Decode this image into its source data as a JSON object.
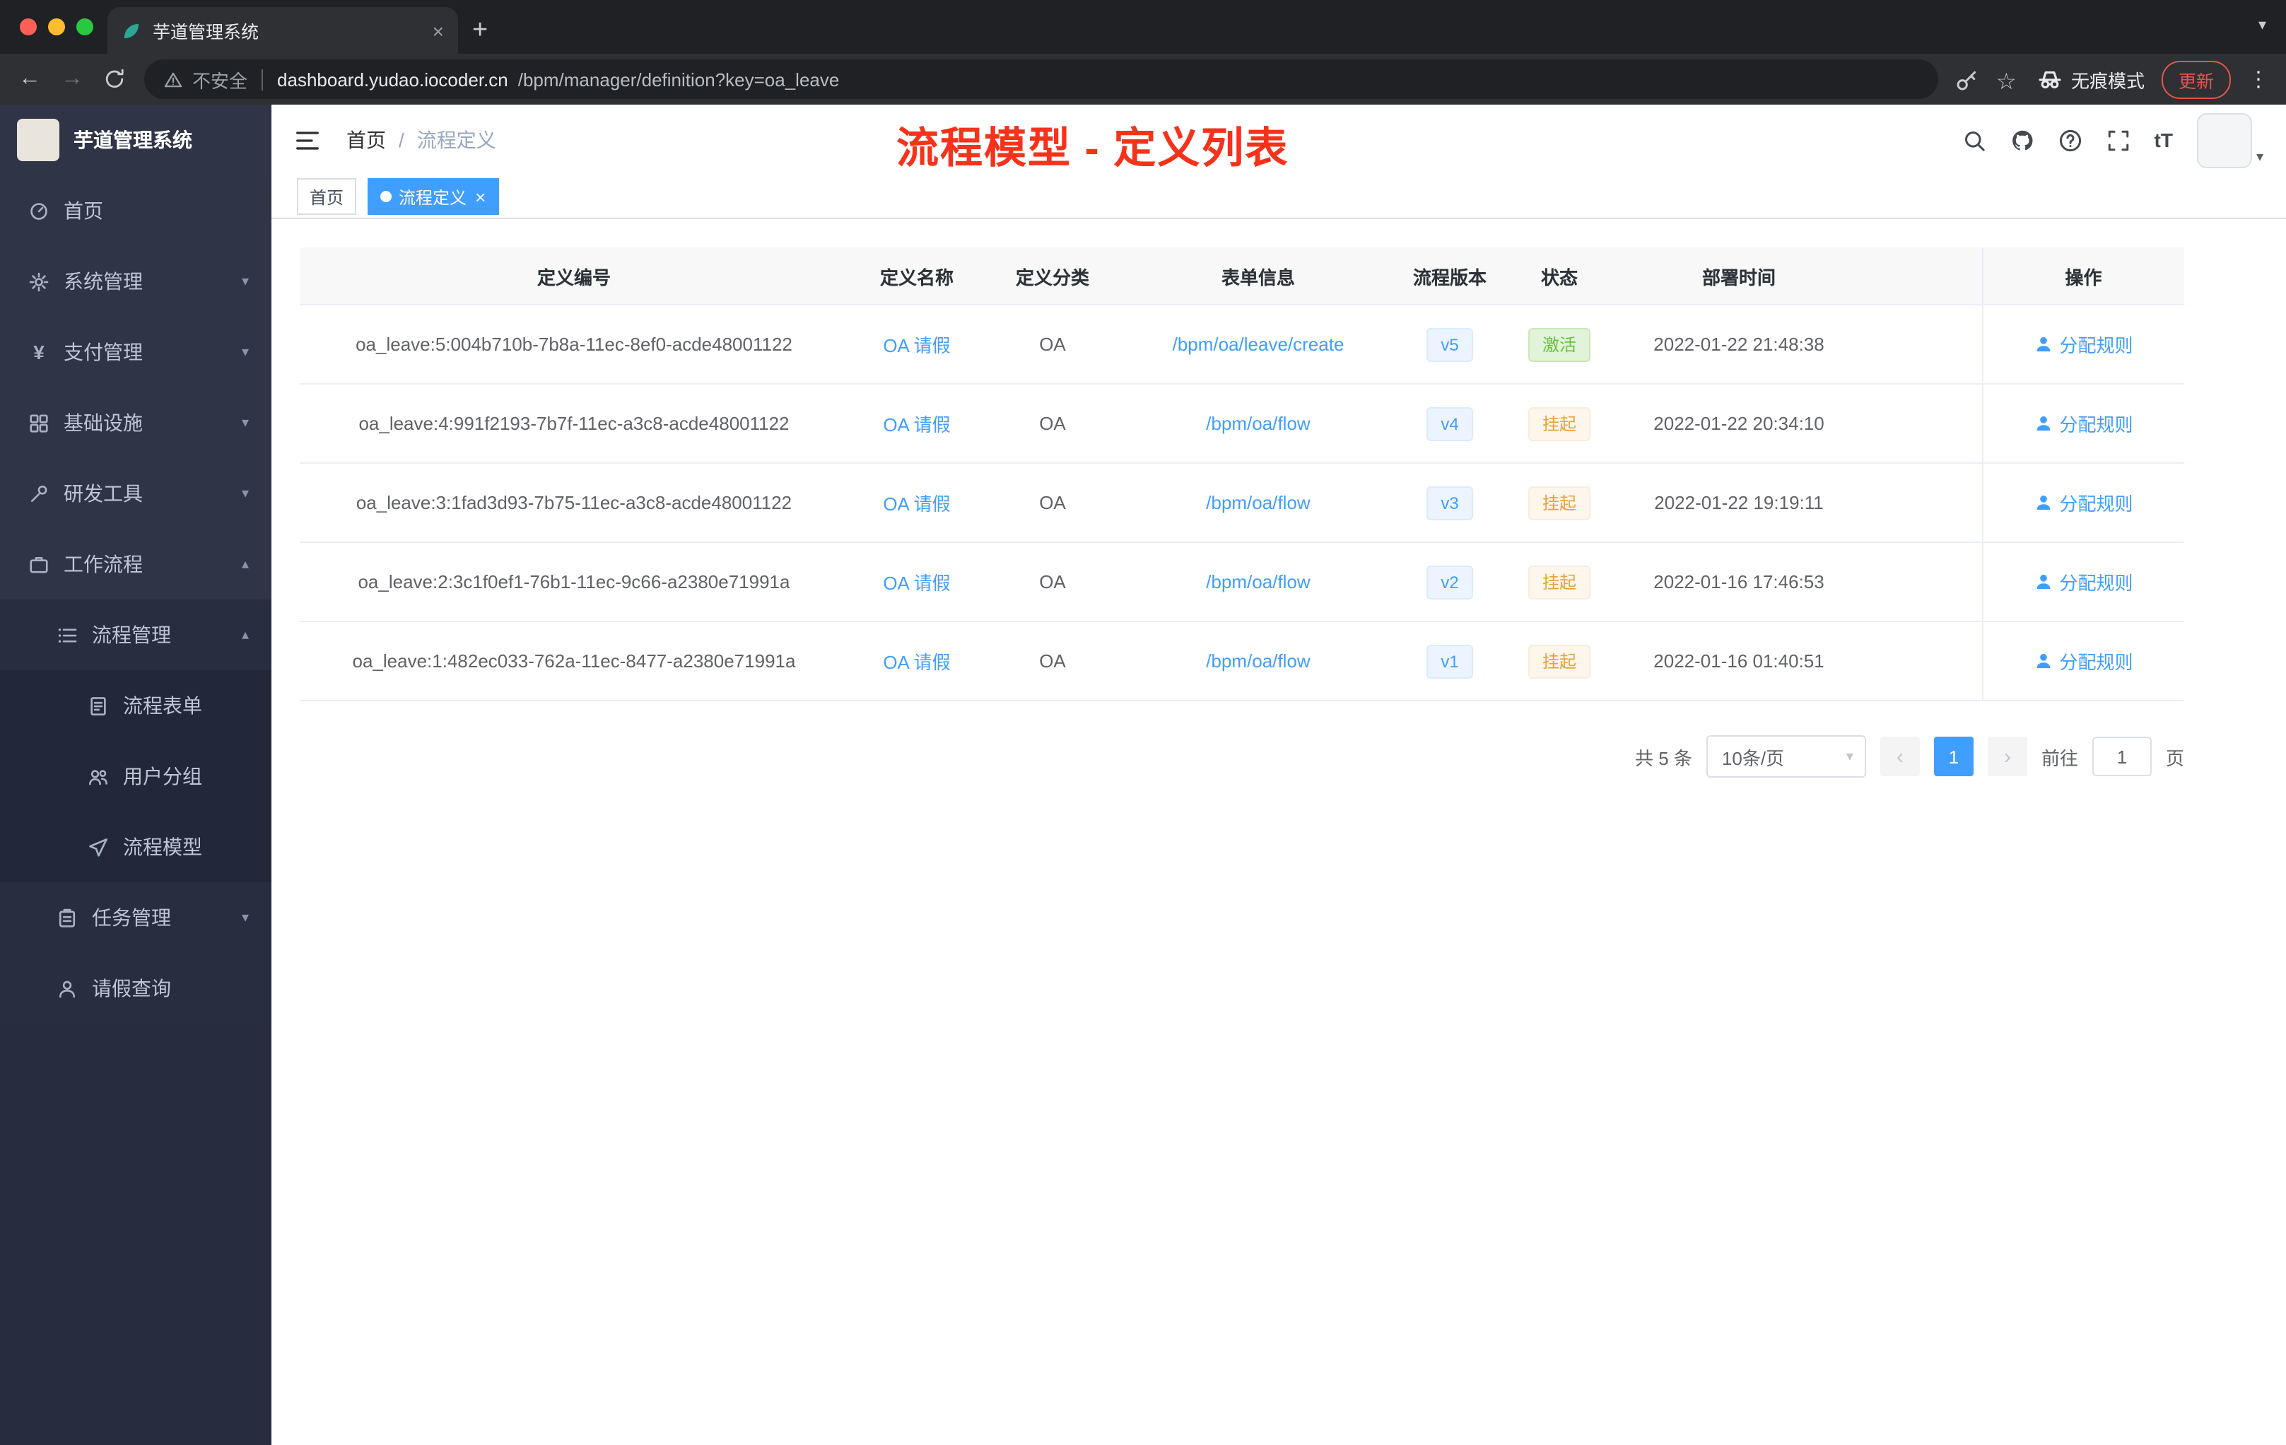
{
  "colors": {
    "primary": "#409eff",
    "success": "#67c23a",
    "warning": "#e6a23c",
    "annotation": "#f6321b"
  },
  "browser": {
    "tab_title": "芋道管理系统",
    "security_label": "不安全",
    "url_domain": "dashboard.yudao.iocoder.cn",
    "url_path": "/bpm/manager/definition?key=oa_leave",
    "incognito_label": "无痕模式",
    "update_label": "更新"
  },
  "sidebar": {
    "logo_title": "芋道管理系统",
    "items": [
      {
        "label": "首页",
        "icon": "dashboard-icon",
        "depth": 0,
        "chevron": null
      },
      {
        "label": "系统管理",
        "icon": "gear-icon",
        "depth": 0,
        "chevron": "down"
      },
      {
        "label": "支付管理",
        "icon": "yen-icon",
        "depth": 0,
        "chevron": "down"
      },
      {
        "label": "基础设施",
        "icon": "infra-icon",
        "depth": 0,
        "chevron": "down"
      },
      {
        "label": "研发工具",
        "icon": "tools-icon",
        "depth": 0,
        "chevron": "down"
      },
      {
        "label": "工作流程",
        "icon": "workflow-icon",
        "depth": 0,
        "chevron": "up"
      },
      {
        "label": "流程管理",
        "icon": "process-icon",
        "depth": 1,
        "chevron": "up"
      },
      {
        "label": "流程表单",
        "icon": "form-icon",
        "depth": 2,
        "chevron": null
      },
      {
        "label": "用户分组",
        "icon": "usergroup-icon",
        "depth": 2,
        "chevron": null
      },
      {
        "label": "流程模型",
        "icon": "model-icon",
        "depth": 2,
        "chevron": null
      },
      {
        "label": "任务管理",
        "icon": "task-icon",
        "depth": 1,
        "chevron": "down"
      },
      {
        "label": "请假查询",
        "icon": "person-icon",
        "depth": 1,
        "chevron": null
      }
    ]
  },
  "header": {
    "breadcrumb_home": "首页",
    "breadcrumb_current": "流程定义",
    "annotation": "流程模型 - 定义列表"
  },
  "tags": [
    {
      "label": "首页",
      "active": false
    },
    {
      "label": "流程定义",
      "active": true
    }
  ],
  "table": {
    "columns": [
      "定义编号",
      "定义名称",
      "定义分类",
      "表单信息",
      "流程版本",
      "状态",
      "部署时间",
      "操作"
    ],
    "rows": [
      {
        "id": "oa_leave:5:004b710b-7b8a-11ec-8ef0-acde48001122",
        "name": "OA 请假",
        "category": "OA",
        "form": "/bpm/oa/leave/create",
        "version": "v5",
        "status": "激活",
        "status_type": "success",
        "deploy_time": "2022-01-22 21:48:38",
        "action": "分配规则"
      },
      {
        "id": "oa_leave:4:991f2193-7b7f-11ec-a3c8-acde48001122",
        "name": "OA 请假",
        "category": "OA",
        "form": "/bpm/oa/flow",
        "version": "v4",
        "status": "挂起",
        "status_type": "warning",
        "deploy_time": "2022-01-22 20:34:10",
        "action": "分配规则"
      },
      {
        "id": "oa_leave:3:1fad3d93-7b75-11ec-a3c8-acde48001122",
        "name": "OA 请假",
        "category": "OA",
        "form": "/bpm/oa/flow",
        "version": "v3",
        "status": "挂起",
        "status_type": "warning",
        "deploy_time": "2022-01-22 19:19:11",
        "action": "分配规则"
      },
      {
        "id": "oa_leave:2:3c1f0ef1-76b1-11ec-9c66-a2380e71991a",
        "name": "OA 请假",
        "category": "OA",
        "form": "/bpm/oa/flow",
        "version": "v2",
        "status": "挂起",
        "status_type": "warning",
        "deploy_time": "2022-01-16 17:46:53",
        "action": "分配规则"
      },
      {
        "id": "oa_leave:1:482ec033-762a-11ec-8477-a2380e71991a",
        "name": "OA 请假",
        "category": "OA",
        "form": "/bpm/oa/flow",
        "version": "v1",
        "status": "挂起",
        "status_type": "warning",
        "deploy_time": "2022-01-16 01:40:51",
        "action": "分配规则"
      }
    ]
  },
  "pagination": {
    "total_text": "共 5 条",
    "page_size": "10条/页",
    "current_page": "1",
    "goto_label": "前往",
    "goto_value": "1",
    "page_suffix": "页"
  }
}
